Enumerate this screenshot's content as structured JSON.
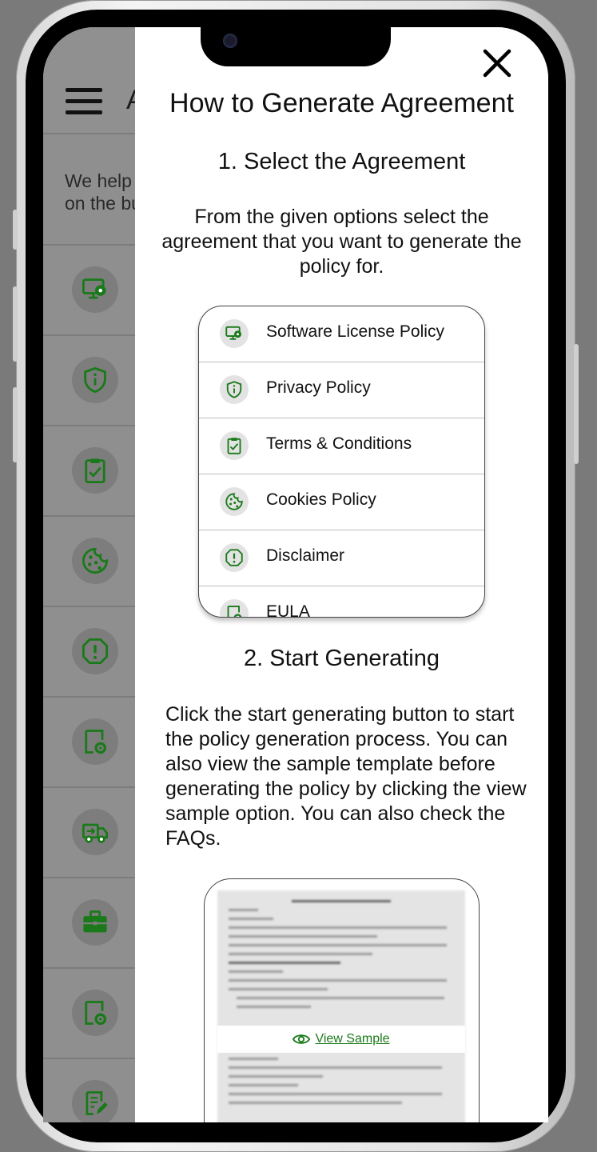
{
  "colors": {
    "accent_green": "#1a7a1a",
    "overlay": "#8f8f8f"
  },
  "background_app": {
    "title_fragment": "A",
    "intro_line1": "We help",
    "intro_line2": "on the bu",
    "icons": [
      "monitor-icon",
      "shield-icon",
      "clipboard-check-icon",
      "cookie-icon",
      "alert-octagon-icon",
      "doc-gear-icon",
      "truck-icon",
      "briefcase-icon",
      "doc-gear-icon",
      "edit-doc-icon"
    ]
  },
  "modal": {
    "title": "How to Generate Agreement",
    "close_icon": "close-icon",
    "step1": {
      "title": "1. Select the Agreement",
      "description": "From the given options select the agreement that you want to generate the policy for."
    },
    "preview_items": [
      {
        "label": "Software License Policy",
        "icon": "monitor-icon"
      },
      {
        "label": "Privacy Policy",
        "icon": "shield-icon"
      },
      {
        "label": "Terms & Conditions",
        "icon": "clipboard-check-icon"
      },
      {
        "label": "Cookies Policy",
        "icon": "cookie-icon"
      },
      {
        "label": "Disclaimer",
        "icon": "alert-octagon-icon"
      },
      {
        "label": "EULA",
        "icon": "doc-gear-icon"
      }
    ],
    "step2": {
      "title": "2. Start Generating",
      "description": "Click the start generating button to start the policy generation process. You can also view the sample template before generating the policy by clicking the view sample option. You can also check the FAQs."
    },
    "view_sample_label": "View Sample"
  }
}
